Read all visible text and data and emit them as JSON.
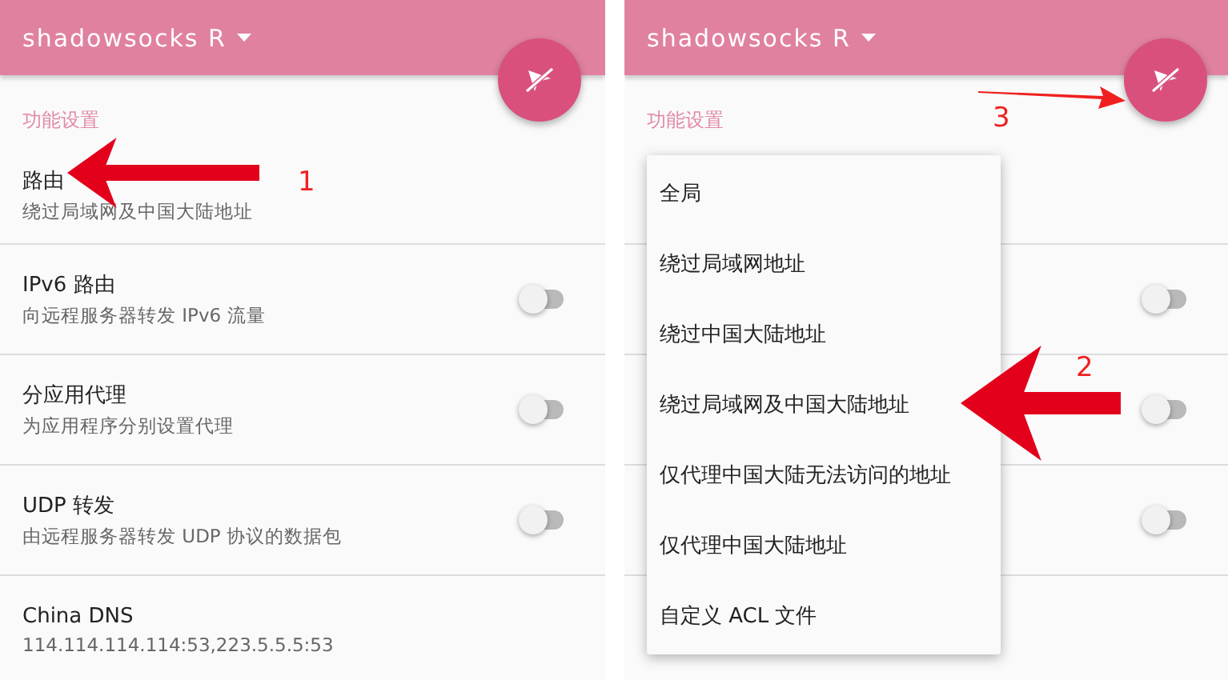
{
  "screens": [
    {
      "app_title": "shadowsocks R",
      "section": "功能设置",
      "rows": [
        {
          "kind": "value",
          "title": "路由",
          "subtitle": "绕过局域网及中国大陆地址"
        },
        {
          "kind": "switch",
          "title": "IPv6 路由",
          "subtitle": "向远程服务器转发 IPv6 流量",
          "on": false
        },
        {
          "kind": "switch",
          "title": "分应用代理",
          "subtitle": "为应用程序分别设置代理",
          "on": false
        },
        {
          "kind": "switch",
          "title": "UDP 转发",
          "subtitle": "由远程服务器转发 UDP 协议的数据包",
          "on": false
        },
        {
          "kind": "value",
          "title": "China DNS",
          "subtitle": "114.114.114.114:53,223.5.5.5:53"
        }
      ]
    },
    {
      "app_title": "shadowsocks R",
      "section": "功能设置",
      "rows": [
        {
          "kind": "hidden"
        },
        {
          "kind": "switch",
          "on": false
        },
        {
          "kind": "switch",
          "on": false
        },
        {
          "kind": "switch",
          "on": false
        },
        {
          "kind": "hidden"
        }
      ],
      "menu": {
        "items": [
          {
            "label": "全局"
          },
          {
            "label": "绕过局域网地址"
          },
          {
            "label": "绕过中国大陆地址"
          },
          {
            "label": "绕过局域网及中国大陆地址"
          },
          {
            "label": "仅代理中国大陆无法访问的地址"
          },
          {
            "label": "仅代理中国大陆地址"
          },
          {
            "label": "自定义 ACL 文件"
          }
        ]
      }
    }
  ],
  "annotations": [
    {
      "kind": "big-arrow",
      "number": "1"
    },
    {
      "kind": "big-arrow",
      "number": "2"
    },
    {
      "kind": "thin-arrow",
      "number": "3"
    }
  ]
}
